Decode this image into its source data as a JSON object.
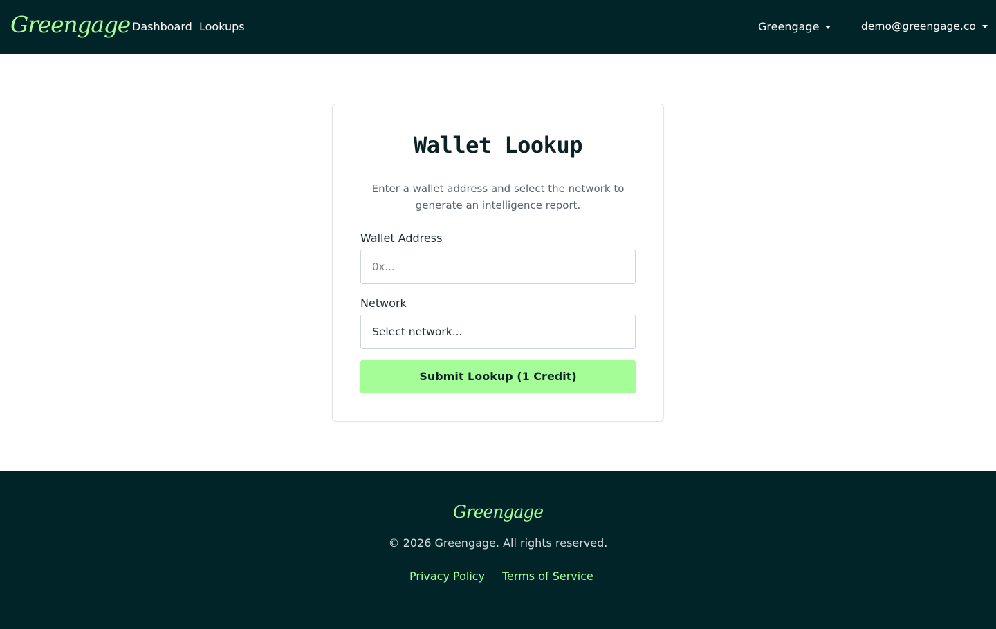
{
  "navbar": {
    "brand": "Greengage",
    "links": [
      "Dashboard",
      "Lookups"
    ],
    "org_menu": "Greengage",
    "user_menu": "demo@greengage.co",
    "icons": {
      "dropdown": "caret-down-icon"
    }
  },
  "lookup_card": {
    "title": "Wallet Lookup",
    "description": "Enter a wallet address and select the network to generate an intelligence report.",
    "address_label": "Wallet Address",
    "address_placeholder": "0x...",
    "network_label": "Network",
    "network_selected": "Select network...",
    "submit_label": "Submit Lookup (1 Credit)"
  },
  "footer": {
    "brand": "Greengage",
    "copyright": "© 2026 Greengage. All rights reserved.",
    "links": [
      "Privacy Policy",
      "Terms of Service"
    ]
  },
  "colors": {
    "nav_bg": "#012428",
    "accent": "#a4fd96",
    "page_bg": "#ffffff"
  }
}
